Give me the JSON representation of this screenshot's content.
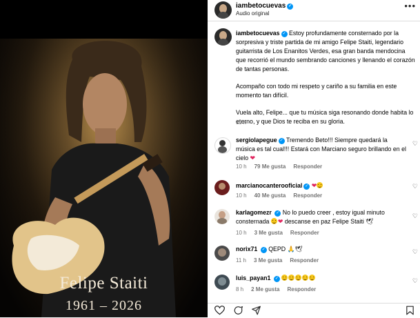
{
  "photo": {
    "name": "Felipe Staiti",
    "years": "1961 – 2026"
  },
  "header": {
    "username": "iambetocuevas",
    "subtitle": "Audio original",
    "more_label": "•••"
  },
  "caption": {
    "username": "iambetocuevas",
    "paragraph1": "Estoy profundamente consternado por la sorpresiva y triste partida de mi amigo Felipe Staiti, legendario guitarrista de Los Enanitos Verdes, esa gran banda mendocina que recorrió el mundo sembrando canciones y llenando el corazón de tantas personas.",
    "paragraph2": "Acompaño con todo mi respeto y cariño a su familia en este momento tan difícil.",
    "paragraph3": "Vuela alto, Felipe... que tu música siga resonando donde habita lo eterno, y que Dios te reciba en su gloria.",
    "time": "11 h"
  },
  "comments": [
    {
      "username": "sergiolapegue",
      "text": "Tremendo Beto!!! Siempre quedará la música es tal cual!!! Estará con Marciano seguro brillando en el cielo",
      "time": "10 h",
      "likes": "79 Me gusta",
      "reply": "Responder"
    },
    {
      "username": "marcianocanterooficial",
      "text": "",
      "time": "10 h",
      "likes": "40 Me gusta",
      "reply": "Responder"
    },
    {
      "username": "karlagomezr",
      "text_a": "No lo puedo creer , estoy igual minuto consternada",
      "text_b": "descanse en paz Felipe Staiti",
      "time": "10 h",
      "likes": "3 Me gusta",
      "reply": "Responder"
    },
    {
      "username": "norix71",
      "text": "QEPD",
      "time": "11 h",
      "likes": "3 Me gusta",
      "reply": "Responder"
    },
    {
      "username": "luis_payan1",
      "text": "",
      "time": "8 h",
      "likes": "2 Me gusta",
      "reply": "Responder"
    }
  ],
  "colors": {
    "verified": "#0095f6",
    "meta_gray": "#737373",
    "heart_red": "#e0245e"
  },
  "icons": [
    "heart-icon",
    "comment-icon",
    "share-icon",
    "bookmark-icon",
    "more-icon",
    "verified-icon"
  ]
}
